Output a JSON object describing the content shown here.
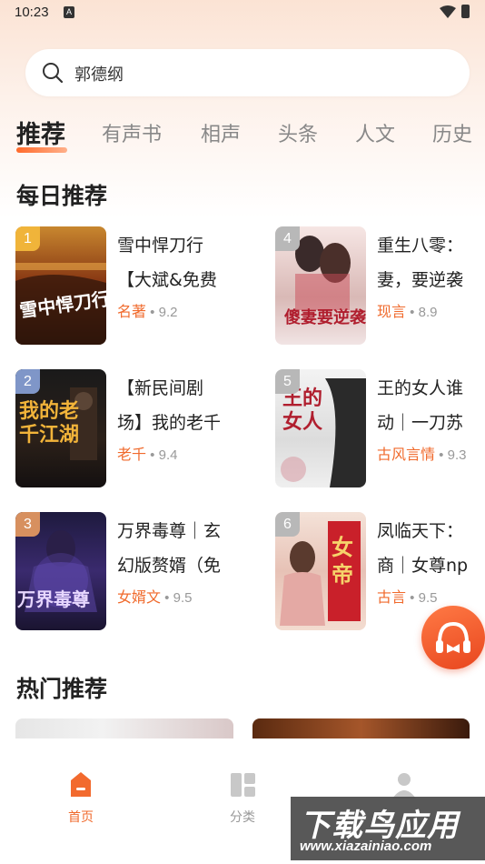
{
  "status": {
    "time": "10:23",
    "notif": "A"
  },
  "search": {
    "query": "郭德纲"
  },
  "tabs": [
    "推荐",
    "有声书",
    "相声",
    "头条",
    "人文",
    "历史"
  ],
  "daily": {
    "title": "每日推荐",
    "books": [
      {
        "rank": "1",
        "line1": "雪中悍刀行",
        "line2": "【大斌&免费",
        "category": "名著",
        "score": "9.2"
      },
      {
        "rank": "4",
        "line1": "重生八零：",
        "line2": "妻，要逆袭",
        "category": "现言",
        "score": "8.9"
      },
      {
        "rank": "2",
        "line1": "【新民间剧",
        "line2": "场】我的老千",
        "category": "老千",
        "score": "9.4"
      },
      {
        "rank": "5",
        "line1": "王的女人谁",
        "line2": "动｜一刀苏",
        "category": "古风言情",
        "score": "9.3"
      },
      {
        "rank": "3",
        "line1": "万界毒尊｜玄",
        "line2": "幻版赘婿（免",
        "category": "女婿文",
        "score": "9.5"
      },
      {
        "rank": "6",
        "line1": "凤临天下：",
        "line2": "商｜女尊np",
        "category": "古言",
        "score": "9.5"
      }
    ],
    "cover_texts": {
      "c1": "雪中悍刀行",
      "c4": "傻妻要逆袭",
      "c2": "我的老千江湖",
      "c5": "王的女人",
      "c3": "万界毒尊",
      "c6": "女帝"
    }
  },
  "hot": {
    "title": "热门推荐"
  },
  "nav": {
    "home": "首页",
    "category": "分类"
  },
  "watermark": {
    "big": "下载鸟应用",
    "small": "www.xiazainiao.com"
  },
  "colors": {
    "accent": "#f06a2c",
    "rank1": "#f0b43a",
    "rank2": "#7f96c8",
    "rank3": "#d7905f"
  }
}
